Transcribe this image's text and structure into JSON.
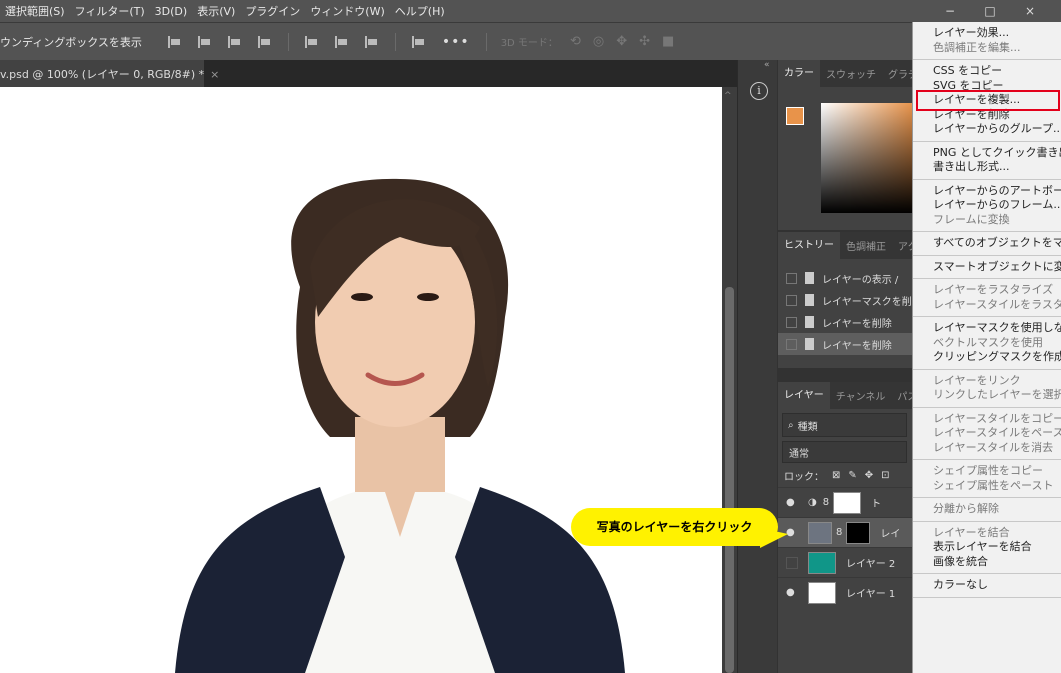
{
  "menubar": {
    "items": [
      "選択範囲(S)",
      "フィルター(T)",
      "3D(D)",
      "表示(V)",
      "プラグイン",
      "ウィンドウ(W)",
      "ヘルプ(H)"
    ]
  },
  "window_controls": {
    "minimize": "−",
    "maximize": "□",
    "close": "×"
  },
  "options_bar": {
    "bounding_box_label": "ウンディングボックスを表示",
    "more": "•••",
    "mode_3d_label": "3D モード："
  },
  "document": {
    "tab_title": "v.psd @ 100% (レイヤー 0, RGB/8#) *",
    "close": "×"
  },
  "strip": {
    "collapse": "«",
    "info": "i"
  },
  "color_panel": {
    "tabs": [
      "カラー",
      "スウォッチ",
      "グラデー"
    ],
    "foreground_color": "#e8934a",
    "background_color": "#ffffff"
  },
  "history_panel": {
    "tabs": [
      "ヒストリー",
      "色調補正",
      "アク"
    ],
    "items": [
      "レイヤーの表示 /",
      "レイヤーマスクを削",
      "レイヤーを削除",
      "レイヤーを削除"
    ]
  },
  "layers_panel": {
    "tabs": [
      "レイヤー",
      "チャンネル",
      "パス"
    ],
    "search_label": "種類",
    "blend_mode": "通常",
    "lock_label": "ロック：",
    "layers": [
      {
        "name": "ト",
        "visible": true
      },
      {
        "name": "レイ",
        "visible": true
      },
      {
        "name": "レイヤー 2",
        "visible": false
      },
      {
        "name": "レイヤー 1",
        "visible": true
      }
    ]
  },
  "context_menu": {
    "groups": [
      [
        {
          "label": "レイヤー効果...",
          "enabled": true
        },
        {
          "label": "色調補正を編集...",
          "enabled": false
        }
      ],
      [
        {
          "label": "CSS をコピー",
          "enabled": true
        },
        {
          "label": "SVG をコピー",
          "enabled": true
        },
        {
          "label": "レイヤーを複製...",
          "enabled": true,
          "highlight": true
        },
        {
          "label": "レイヤーを削除",
          "enabled": true
        },
        {
          "label": "レイヤーからのグループ...",
          "enabled": true
        }
      ],
      [
        {
          "label": "PNG としてクイック書き出し",
          "enabled": true
        },
        {
          "label": "書き出し形式...",
          "enabled": true
        }
      ],
      [
        {
          "label": "レイヤーからのアートボード...",
          "enabled": true
        },
        {
          "label": "レイヤーからのフレーム...",
          "enabled": true
        },
        {
          "label": "フレームに変換",
          "enabled": false
        }
      ],
      [
        {
          "label": "すべてのオブジェクトをマスク",
          "enabled": true
        }
      ],
      [
        {
          "label": "スマートオブジェクトに変換",
          "enabled": true
        }
      ],
      [
        {
          "label": "レイヤーをラスタライズ",
          "enabled": false
        },
        {
          "label": "レイヤースタイルをラスタライズ",
          "enabled": false
        }
      ],
      [
        {
          "label": "レイヤーマスクを使用しない",
          "enabled": true
        },
        {
          "label": "ベクトルマスクを使用",
          "enabled": false
        },
        {
          "label": "クリッピングマスクを作成",
          "enabled": true
        }
      ],
      [
        {
          "label": "レイヤーをリンク",
          "enabled": false
        },
        {
          "label": "リンクしたレイヤーを選択",
          "enabled": false
        }
      ],
      [
        {
          "label": "レイヤースタイルをコピー",
          "enabled": false
        },
        {
          "label": "レイヤースタイルをペースト",
          "enabled": false
        },
        {
          "label": "レイヤースタイルを消去",
          "enabled": false
        }
      ],
      [
        {
          "label": "シェイプ属性をコピー",
          "enabled": false
        },
        {
          "label": "シェイプ属性をペースト",
          "enabled": false
        }
      ],
      [
        {
          "label": "分離から解除",
          "enabled": false
        }
      ],
      [
        {
          "label": "レイヤーを結合",
          "enabled": false
        },
        {
          "label": "表示レイヤーを結合",
          "enabled": true
        },
        {
          "label": "画像を統合",
          "enabled": true
        }
      ],
      [
        {
          "label": "カラーなし",
          "enabled": true
        }
      ]
    ]
  },
  "callout": {
    "text": "写真のレイヤーを右クリック"
  },
  "colors": {
    "highlight_border": "#e3001b",
    "callout_bg": "#fff200",
    "layer2_color": "#109688"
  }
}
